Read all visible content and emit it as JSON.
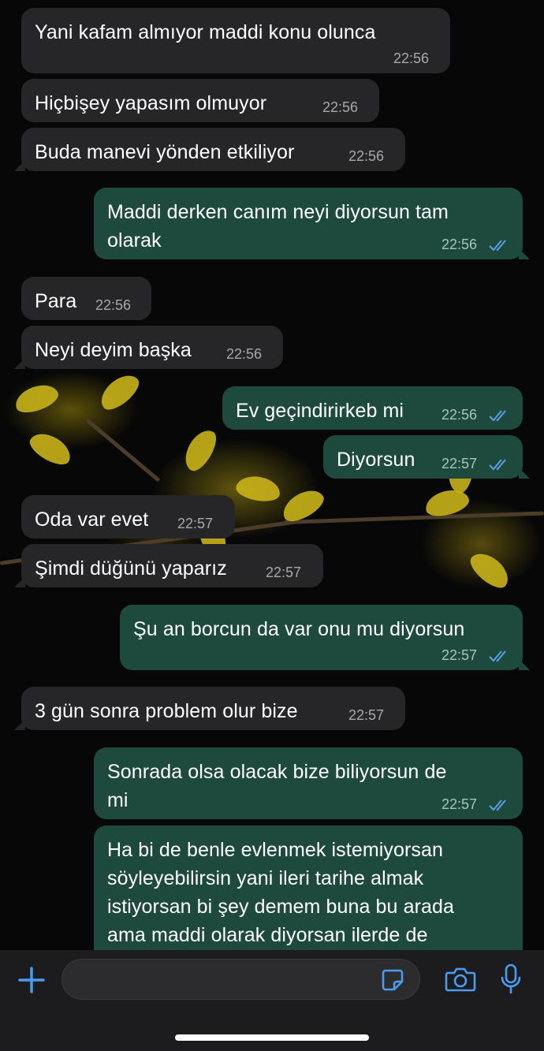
{
  "messages": [
    {
      "direction": "incoming",
      "text": "Yani kafam almıyor maddi konu olunca",
      "time": "22:56"
    },
    {
      "direction": "incoming",
      "text": "Hiçbişey yapasım olmuyor",
      "time": "22:56"
    },
    {
      "direction": "incoming",
      "text": "Buda manevi yönden etkiliyor",
      "time": "22:56"
    },
    {
      "direction": "outgoing",
      "text": "Maddi derken canım neyi diyorsun tam\nolarak",
      "time": "22:56",
      "status": "read"
    },
    {
      "direction": "incoming",
      "text": "Para",
      "time": "22:56"
    },
    {
      "direction": "incoming",
      "text": "Neyi deyim başka",
      "time": "22:56"
    },
    {
      "direction": "outgoing",
      "text": "Ev geçindirirkeb mi",
      "time": "22:56",
      "status": "read"
    },
    {
      "direction": "outgoing",
      "text": "Diyorsun",
      "time": "22:57",
      "status": "read"
    },
    {
      "direction": "incoming",
      "text": "Oda var evet",
      "time": "22:57"
    },
    {
      "direction": "incoming",
      "text": "Şimdi düğünü yaparız",
      "time": "22:57"
    },
    {
      "direction": "outgoing",
      "text": "Şu an borcun da var onu mu diyorsun",
      "time": "22:57",
      "status": "read"
    },
    {
      "direction": "incoming",
      "text": "3 gün sonra problem olur bize",
      "time": "22:57"
    },
    {
      "direction": "outgoing",
      "text": "Sonrada olsa olacak bize biliyorsun de\nmi",
      "time": "22:57",
      "status": "read"
    },
    {
      "direction": "outgoing",
      "text": "Ha bi de benle evlenmek istemiyorsan\nsöyleyebilirsin yani ileri tarihe almak\nistiyorsan bi şey demem buna bu arada\nama maddi olarak diyorsan ilerde de"
    }
  ],
  "composer": {
    "placeholder": "",
    "icons": [
      "plus-icon",
      "sticker-icon",
      "camera-icon",
      "microphone-icon"
    ]
  },
  "colors": {
    "incoming_bubble": "#262628",
    "outgoing_bubble": "#1e4a3e",
    "read_ticks": "#5aa0e6",
    "accent": "#4a9cf0"
  }
}
